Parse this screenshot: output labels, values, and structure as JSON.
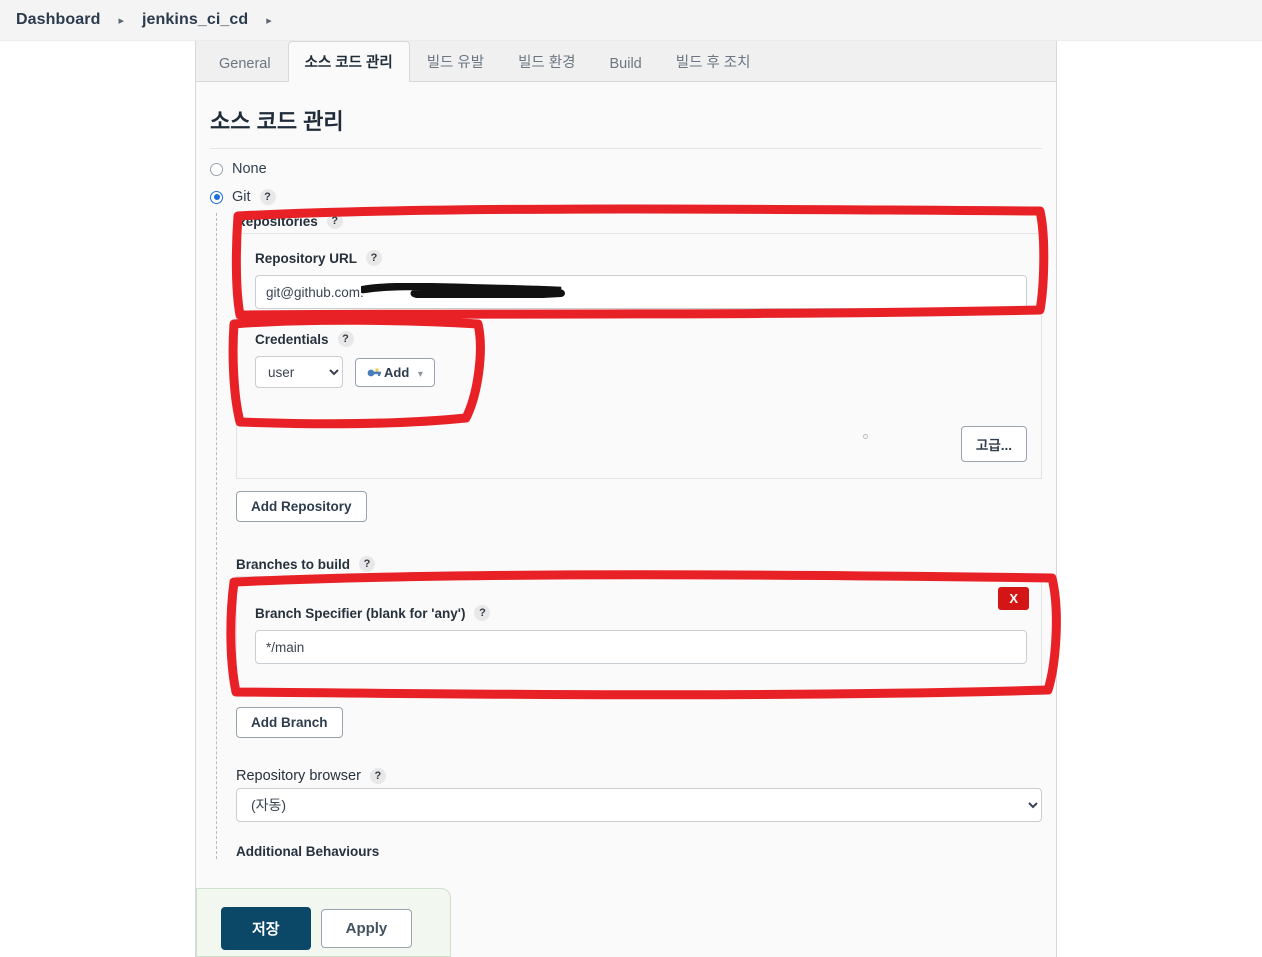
{
  "breadcrumb": {
    "items": [
      {
        "label": "Dashboard"
      },
      {
        "label": "jenkins_ci_cd"
      }
    ],
    "separator": "▸"
  },
  "tabs": [
    {
      "label": "General",
      "active": false
    },
    {
      "label": "소스 코드 관리",
      "active": true
    },
    {
      "label": "빌드 유발",
      "active": false
    },
    {
      "label": "빌드 환경",
      "active": false
    },
    {
      "label": "Build",
      "active": false
    },
    {
      "label": "빌드 후 조치",
      "active": false
    }
  ],
  "page": {
    "title": "소스 코드 관리"
  },
  "scm": {
    "none_label": "None",
    "git_label": "Git",
    "repositories_label": "Repositories",
    "help_glyph": "?"
  },
  "repository": {
    "url_label": "Repository URL",
    "url_value": "git@github.com:",
    "url_placeholder": "",
    "credentials_label": "Credentials",
    "credentials_selected": "user",
    "credentials_options": [
      "user"
    ],
    "add_button_label": "Add",
    "add_caret": "▾",
    "advanced_button_label": "고급...",
    "add_repository_button": "Add Repository"
  },
  "branches": {
    "heading": "Branches to build",
    "specifier_label": "Branch Specifier (blank for 'any')",
    "specifier_value": "*/main",
    "delete_button_label": "X",
    "add_branch_button": "Add Branch"
  },
  "repo_browser": {
    "label": "Repository browser",
    "selected": "(자동)",
    "options": [
      "(자동)"
    ]
  },
  "additional": {
    "label": "Additional Behaviours"
  },
  "footer": {
    "save_label": "저장",
    "apply_label": "Apply"
  },
  "colors": {
    "annotation": "#e82127",
    "accent_radio": "#1d6fdc",
    "save_bg": "#0b4766",
    "delete_bg": "#d41515"
  }
}
